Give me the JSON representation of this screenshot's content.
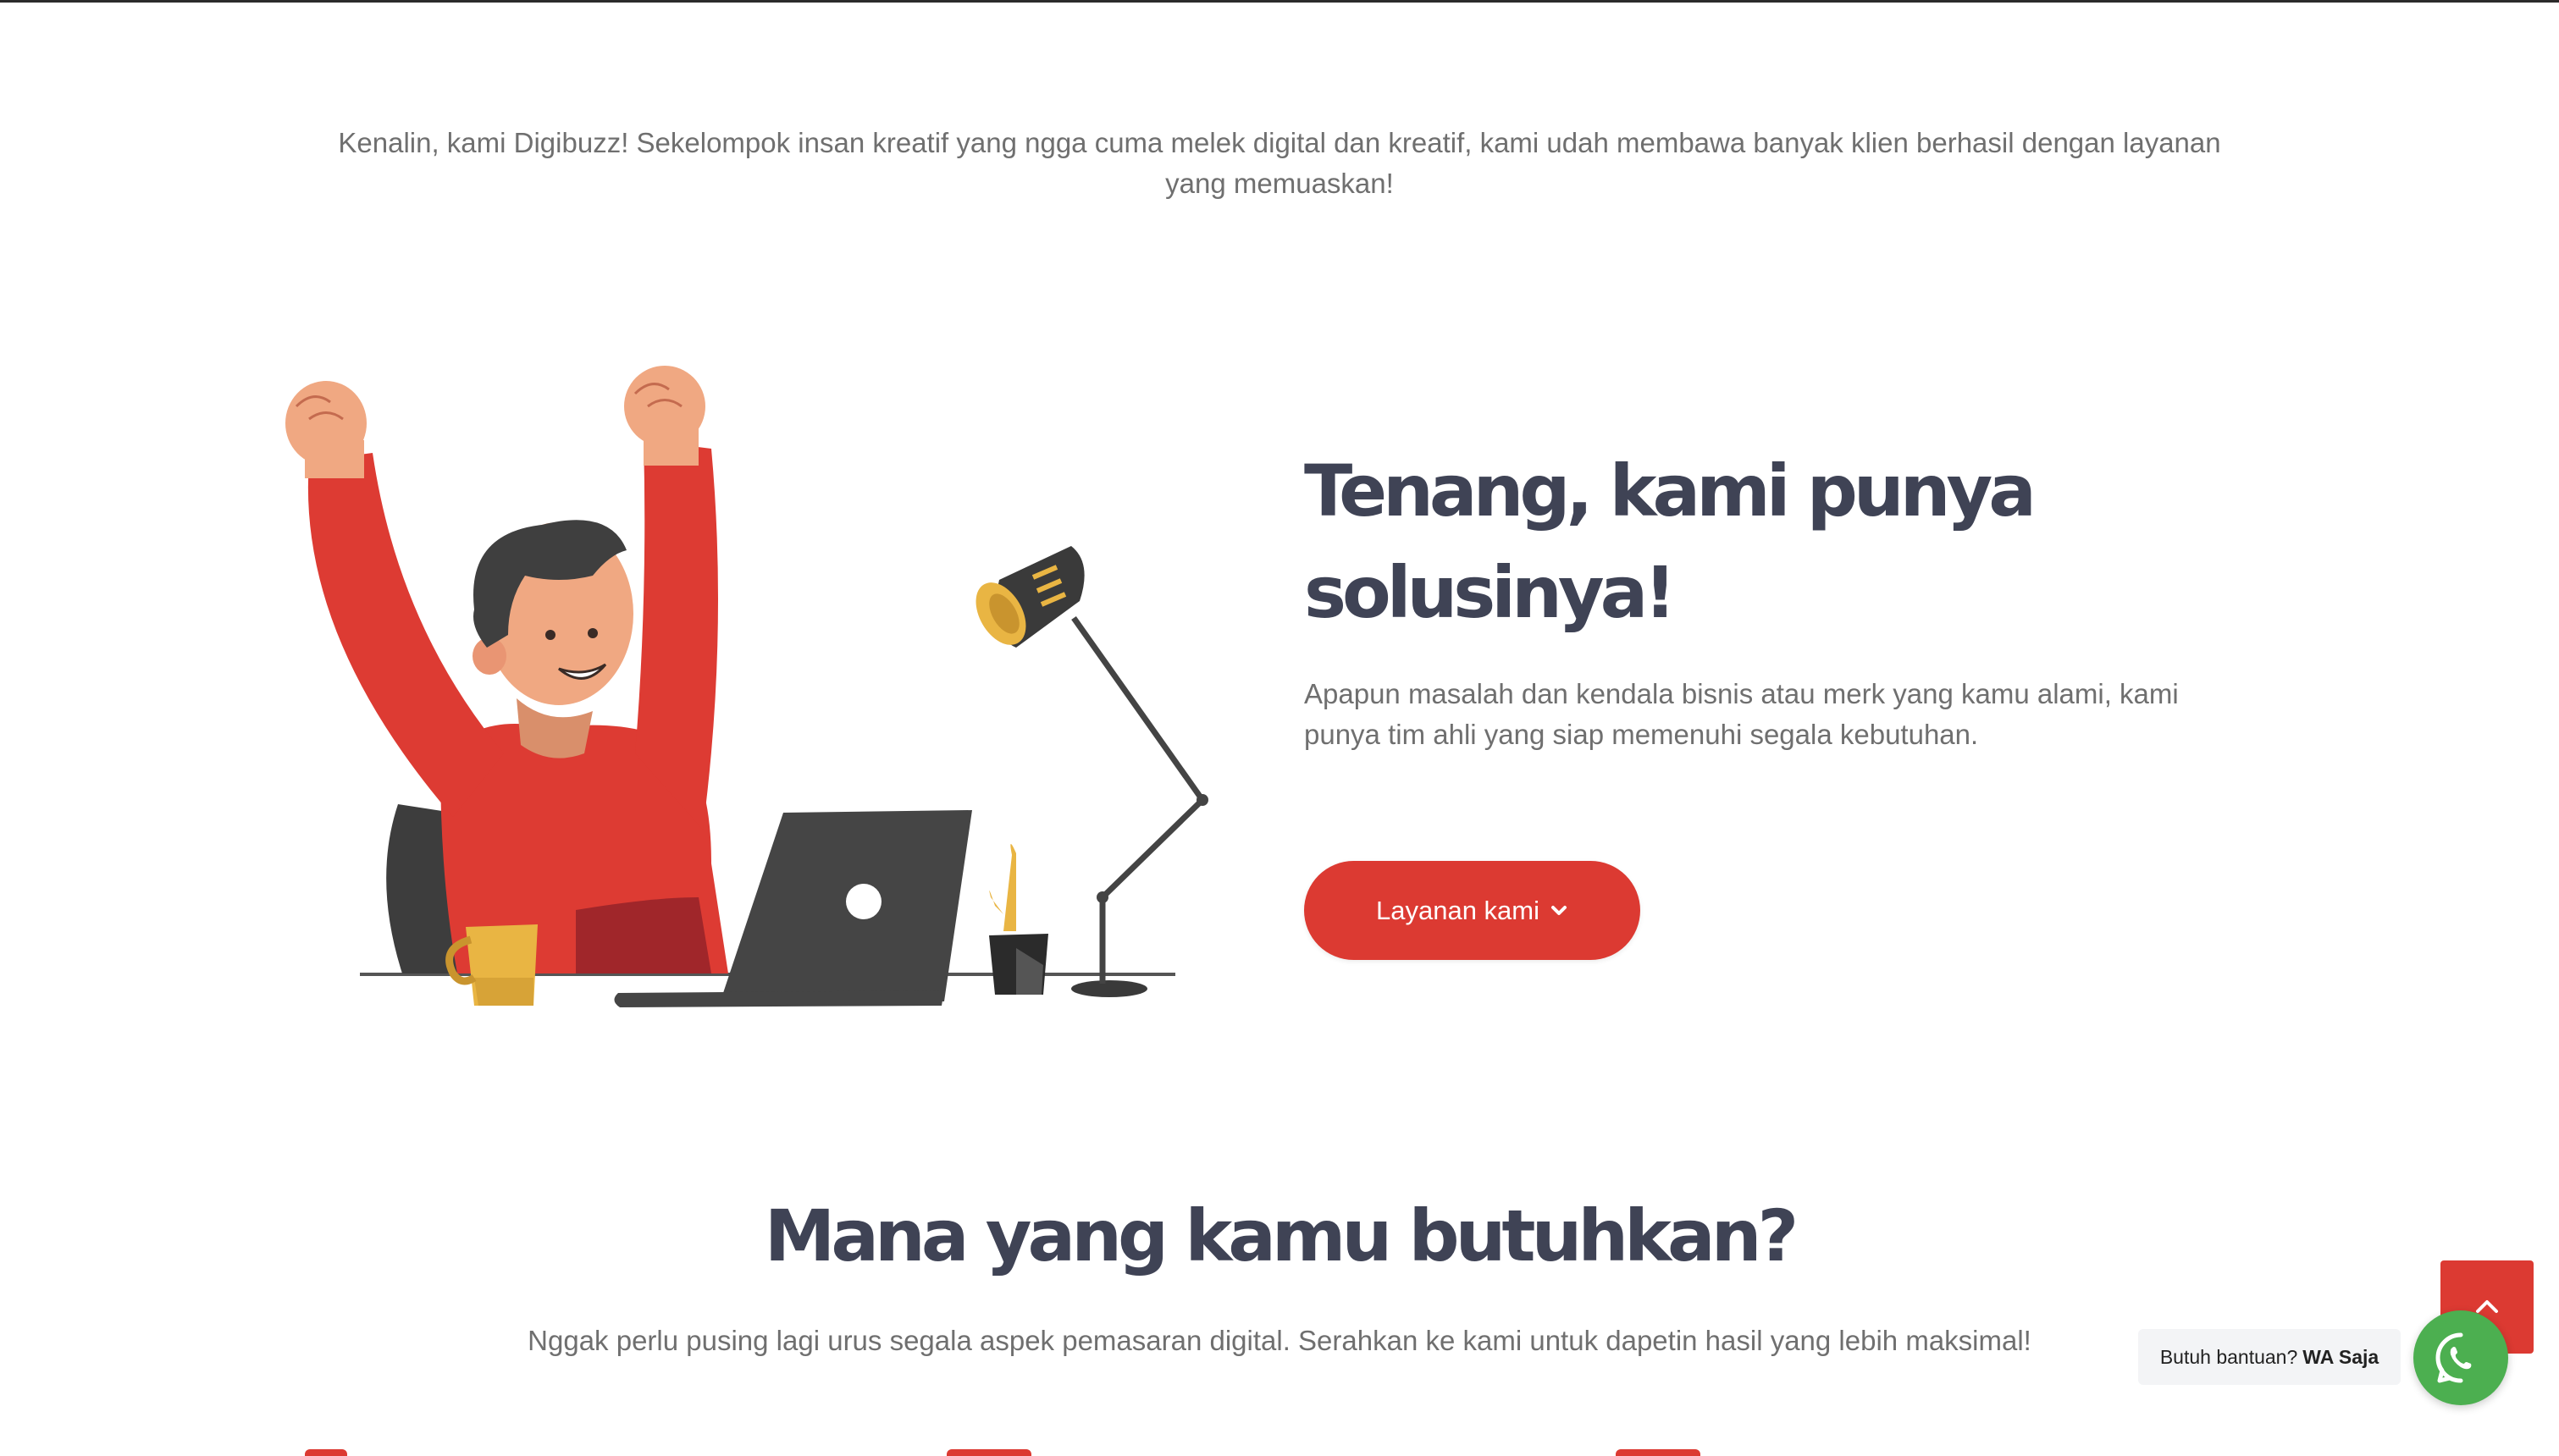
{
  "intro": {
    "text": "Kenalin, kami Digibuzz! Sekelompok insan kreatif yang ngga cuma melek digital dan kreatif, kami udah membawa banyak klien berhasil dengan layanan yang memuaskan!"
  },
  "hero": {
    "headline": "Tenang, kami punya solusinya!",
    "description": "Apapun masalah dan kendala bisnis atau merk yang kamu alami, kami punya tim ahli yang siap memenuhi segala kebutuhan.",
    "button_label": "Layanan kami",
    "button_icon": "chevron-down-icon",
    "illustration": "man-celebrating-at-desk"
  },
  "services": {
    "title": "Mana yang kamu butuhkan?",
    "subtitle": "Nggak perlu pusing lagi urus segala aspek pemasaran digital. Serahkan ke kami untuk dapetin hasil yang lebih maksimal!"
  },
  "floating": {
    "scroll_top_icon": "chevron-up-icon",
    "help_text": "Butuh bantuan?",
    "help_link": "WA Saja",
    "whatsapp_icon": "whatsapp-icon"
  },
  "colors": {
    "accent": "#dc3a32",
    "heading": "#3f4355",
    "body_text": "#6f6f6f",
    "whatsapp": "#4caf50"
  }
}
